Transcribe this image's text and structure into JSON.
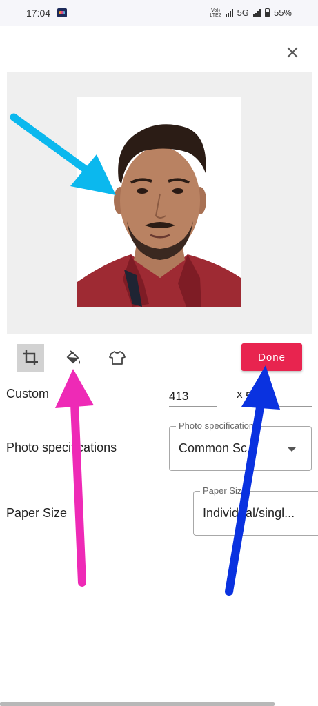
{
  "status_bar": {
    "time": "17:04",
    "network_label": "Vo)) LTE2",
    "network_type": "5G",
    "battery_percent": "55%"
  },
  "dialog": {
    "close_icon": "close-icon"
  },
  "toolbar": {
    "crop_icon": "crop-icon",
    "background_icon": "paint-bucket-icon",
    "clothing_icon": "shirt-icon",
    "done_label": "Done"
  },
  "form": {
    "custom_label": "Custom",
    "width_value": "413",
    "dimension_separator": "x",
    "height_value": "531",
    "photo_spec_label": "Photo specifications",
    "photo_spec_field_label": "Photo specifications",
    "photo_spec_value": "Common Sc...",
    "paper_size_label": "Paper Size",
    "paper_size_field_label": "Paper Size",
    "paper_size_value": "Individual/singl..."
  },
  "colors": {
    "done_button": "#e8244f",
    "arrow_cyan": "#0bb8ee",
    "arrow_magenta": "#ee2ab6",
    "arrow_blue": "#0a32e0",
    "preview_bg": "#efefef"
  }
}
